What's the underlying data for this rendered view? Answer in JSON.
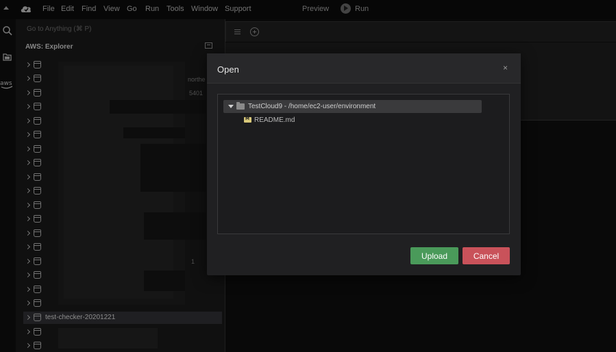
{
  "menubar": {
    "items": [
      "File",
      "Edit",
      "Find",
      "View",
      "Go",
      "Run",
      "Tools",
      "Window",
      "Support"
    ],
    "preview_label": "Preview",
    "run_label": "Run"
  },
  "explorer": {
    "goto_placeholder": "Go to Anything (⌘ P)",
    "title": "AWS: Explorer",
    "visible_bucket_label": "test-checker-20201221",
    "peek_texts": [
      "northe",
      "5401",
      "1"
    ]
  },
  "dialog": {
    "title": "Open",
    "close_label": "×",
    "root_label": "TestCloud9 - /home/ec2-user/environment",
    "file_label": "README.md",
    "upload_label": "Upload",
    "cancel_label": "Cancel"
  },
  "colors": {
    "upload": "#4a9a5a",
    "cancel": "#c9525a",
    "selected_row": "#2a2a2e"
  },
  "icons": [
    "cloud-icon",
    "search-icon",
    "folder-icon",
    "aws-icon",
    "bucket-icon",
    "chevron-right-icon",
    "plus-circle-icon",
    "hamburger-icon",
    "play-icon",
    "markdown-file-icon"
  ]
}
